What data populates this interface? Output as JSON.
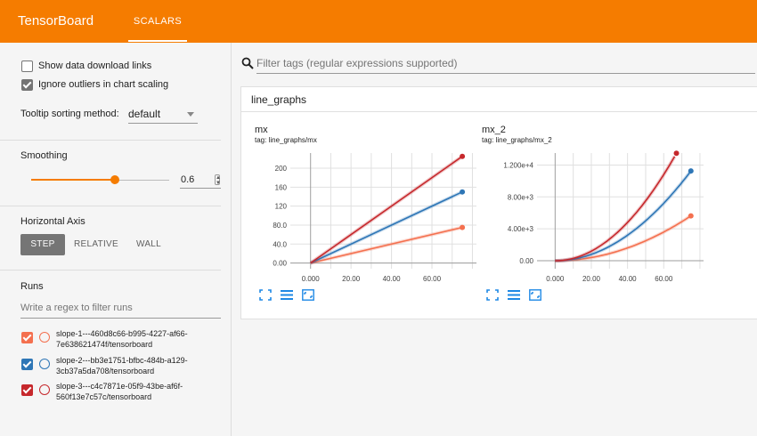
{
  "app": {
    "title": "TensorBoard",
    "tab": "SCALARS"
  },
  "sidebar": {
    "show_download": {
      "label": "Show data download links",
      "checked": false
    },
    "ignore_outliers": {
      "label": "Ignore outliers in chart scaling",
      "checked": true
    },
    "tooltip_sort": {
      "label": "Tooltip sorting method:",
      "value": "default"
    },
    "smoothing": {
      "title": "Smoothing",
      "value": "0.6",
      "fraction": 0.6
    },
    "horizontal_axis": {
      "title": "Horizontal Axis",
      "options": [
        "STEP",
        "RELATIVE",
        "WALL"
      ],
      "selected": "STEP"
    },
    "runs": {
      "title": "Runs",
      "filter_placeholder": "Write a regex to filter runs",
      "items": [
        {
          "line1": "slope-1---460d8c66-b995-4227-af66-",
          "line2": "7e638621474f/tensorboard",
          "color": "#f4704f",
          "checked": true
        },
        {
          "line1": "slope-2---bb3e1751-bfbc-484b-a129-",
          "line2": "3cb37a5da708/tensorboard",
          "color": "#2e76b6",
          "checked": true
        },
        {
          "line1": "slope-3---c4c7871e-05f9-43be-af6f-",
          "line2": "560f13e7c57c/tensorboard",
          "color": "#c6282c",
          "checked": true
        }
      ]
    }
  },
  "main": {
    "filter_placeholder": "Filter tags (regular expressions supported)",
    "group": "line_graphs",
    "charts": [
      {
        "title": "mx",
        "tag": "tag: line_graphs/mx",
        "yticks": [
          "200",
          "160",
          "120",
          "80.0",
          "40.0",
          "0.00"
        ],
        "xticks": [
          "0.000",
          "20.00",
          "40.00",
          "60.00"
        ]
      },
      {
        "title": "mx_2",
        "tag": "tag: line_graphs/mx_2",
        "yticks": [
          "1.200e+4",
          "8.00e+3",
          "4.00e+3",
          "0.00"
        ],
        "xticks": [
          "0.000",
          "20.00",
          "40.00",
          "60.00"
        ]
      }
    ]
  },
  "chart_data": [
    {
      "type": "line",
      "title": "mx",
      "xlim": [
        -10,
        82
      ],
      "ylim": [
        -12,
        232
      ],
      "series": [
        {
          "name": "slope-1",
          "color": "#f4704f",
          "x": [
            0,
            75
          ],
          "y": [
            0,
            75
          ]
        },
        {
          "name": "slope-2",
          "color": "#2e76b6",
          "x": [
            0,
            75
          ],
          "y": [
            0,
            150
          ]
        },
        {
          "name": "slope-3",
          "color": "#c6282c",
          "x": [
            0,
            75
          ],
          "y": [
            0,
            225
          ]
        }
      ]
    },
    {
      "type": "line",
      "title": "mx_2",
      "xlim": [
        -10,
        82
      ],
      "ylim": [
        -1000,
        13500
      ],
      "series": [
        {
          "name": "slope-1",
          "color": "#f4704f",
          "x": [
            0,
            10,
            20,
            30,
            40,
            50,
            60,
            70,
            75
          ],
          "y": [
            0,
            100,
            400,
            900,
            1600,
            2500,
            3600,
            4900,
            5625
          ]
        },
        {
          "name": "slope-2",
          "color": "#2e76b6",
          "x": [
            0,
            10,
            20,
            30,
            40,
            50,
            60,
            70,
            75
          ],
          "y": [
            0,
            200,
            800,
            1800,
            3200,
            5000,
            7200,
            9800,
            11250
          ]
        },
        {
          "name": "slope-3",
          "color": "#c6282c",
          "x": [
            0,
            10,
            20,
            30,
            40,
            50,
            60,
            67
          ],
          "y": [
            0,
            300,
            1200,
            2700,
            4800,
            7500,
            10800,
            13467
          ]
        }
      ]
    }
  ]
}
